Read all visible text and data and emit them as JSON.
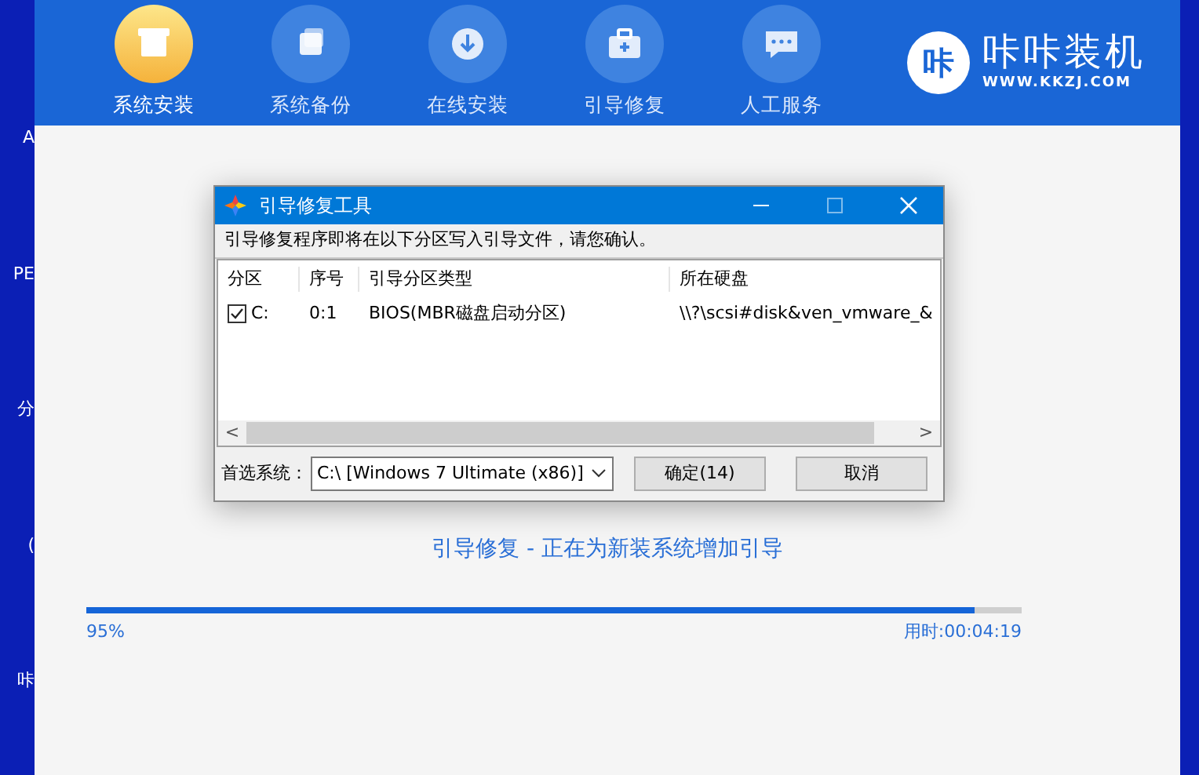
{
  "desktop": {
    "labels": [
      "A",
      "PE",
      "分",
      "(",
      "咔"
    ]
  },
  "nav": {
    "items": [
      {
        "label": "系统安装",
        "selected": true
      },
      {
        "label": "系统备份",
        "selected": false
      },
      {
        "label": "在线安装",
        "selected": false
      },
      {
        "label": "引导修复",
        "selected": false
      },
      {
        "label": "人工服务",
        "selected": false
      }
    ]
  },
  "brand": {
    "mark": "咔",
    "name": "咔咔装机",
    "url": "WWW.KKZJ.COM"
  },
  "dialog": {
    "title": "引导修复工具",
    "message": "引导修复程序即将在以下分区写入引导文件，请您确认。",
    "columns": [
      "分区",
      "序号",
      "引导分区类型",
      "所在硬盘"
    ],
    "rows": [
      {
        "checked": true,
        "cells": [
          "C:",
          "0:1",
          "BIOS(MBR磁盘启动分区)",
          "\\\\?\\scsi#disk&ven_vmware_&"
        ]
      }
    ],
    "scroll_left": "<",
    "scroll_right": ">",
    "system_label": "首选系统：",
    "system_value": "C:\\ [Windows 7 Ultimate (x86)]",
    "buttons": [
      "确定(14)",
      "取消"
    ]
  },
  "status": "引导修复 - 正在为新装系统增加引导",
  "progress": {
    "level": 0.95,
    "percent": "95%",
    "elapsed": "用时:00:04:19"
  }
}
